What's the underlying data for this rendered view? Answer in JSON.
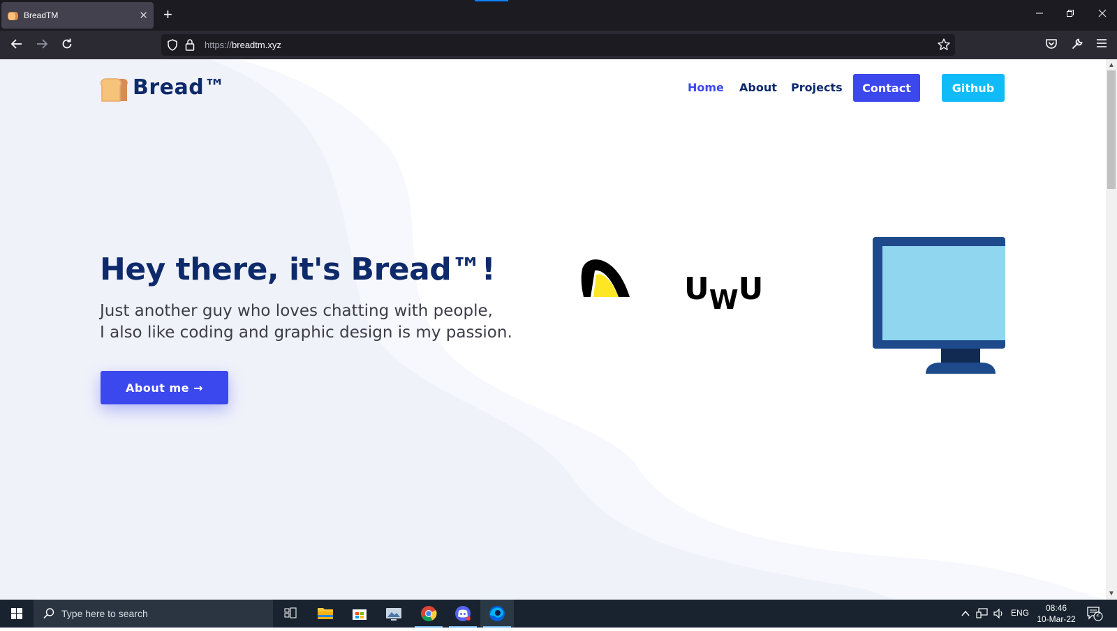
{
  "browser": {
    "tab_title": "BreadTM",
    "tab_close": "✕",
    "new_tab": "+",
    "url_protocol": "https://",
    "url_host": "breadtm.xyz"
  },
  "site": {
    "brand": "Bread™",
    "nav": [
      "Home",
      "About",
      "Projects"
    ],
    "contact_label": "Contact",
    "github_label": "Github",
    "colors": {
      "primary": "#3b48ee",
      "github": "#0fbcf9",
      "heading": "#0e2a6b"
    }
  },
  "hero": {
    "title": "Hey there, it's Bread™!",
    "subtitle_line1": "Just another guy who loves chatting with people,",
    "subtitle_line2": "I also like coding and graphic design is my passion.",
    "cta": "About me →",
    "uwu_left": "U",
    "uwu_mid": "W",
    "uwu_right": "U"
  },
  "taskbar": {
    "search_placeholder": "Type here to search",
    "lang": "ENG",
    "time": "08:46",
    "date": "10-Mar-22",
    "notifications": "2",
    "apps": [
      "task-view-icon",
      "file-explorer-icon",
      "store-icon",
      "photos-icon",
      "chrome-icon",
      "discord-icon",
      "firefox-icon"
    ]
  }
}
